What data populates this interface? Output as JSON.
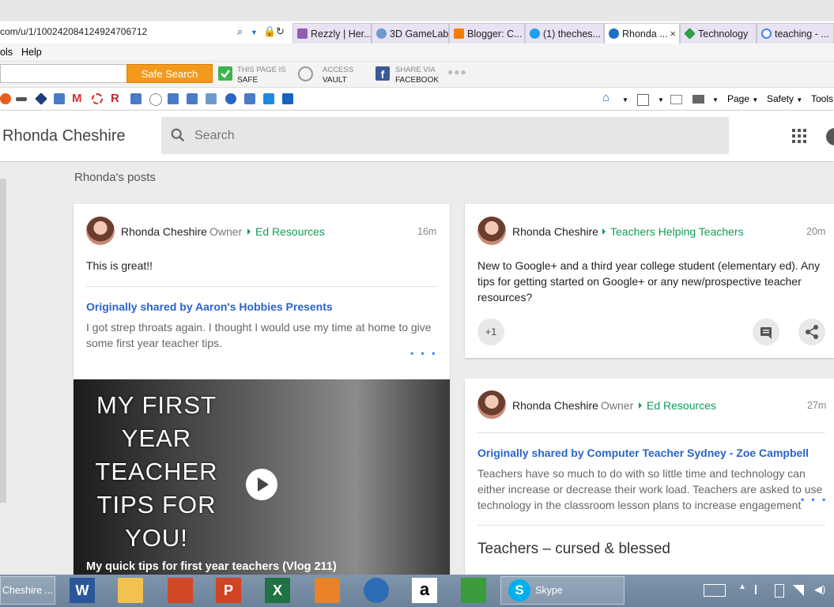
{
  "browser": {
    "address": "com/u/1/100242084124924706712",
    "tabs": [
      {
        "label": "Rezzly | Her...",
        "color": "#8e5fb0"
      },
      {
        "label": "3D GameLab",
        "color": "#6d9acb"
      },
      {
        "label": "Blogger: C...",
        "color": "#f57d00"
      },
      {
        "label": "(1) theches...",
        "color": "#1da1f2"
      },
      {
        "label": "Rhonda ...",
        "color": "#1e6fc8",
        "close": "×"
      },
      {
        "label": "Technology",
        "color": "#2f9e44"
      },
      {
        "label": "teaching - ...",
        "color": "#4285f4"
      }
    ],
    "menu": {
      "tools": "ols",
      "help": "Help"
    },
    "safebar": {
      "safe_search": "Safe Search",
      "page_safe_line1": "THIS PAGE IS",
      "page_safe_line2": "SAFE",
      "access_line1": "ACCESS",
      "access_line2": "VAULT",
      "share_line1": "SHARE VIA",
      "share_line2": "FACEBOOK",
      "more": "●●●"
    },
    "commands": {
      "page": "Page",
      "safety": "Safety",
      "tools": "Tools"
    }
  },
  "gplus": {
    "profile_name": "Rhonda Cheshire",
    "search_placeholder": "Search",
    "posts_heading": "Rhonda's posts"
  },
  "posts": [
    {
      "author": "Rhonda Cheshire",
      "role": "Owner",
      "community": "Ed Resources",
      "time": "16m",
      "text": "This is great!!",
      "shared_by": "Originally shared by Aaron's Hobbies Presents",
      "shared_text": "I got strep throats again. I thought I would use my time at home to give some first year teacher tips.",
      "more": "• • •",
      "video_title_text": "MY FIRST YEAR TEACHER TIPS FOR YOU!",
      "video_caption": "My quick tips for first year teachers (Vlog 211)"
    },
    {
      "author": "Rhonda Cheshire",
      "community": "Teachers Helping Teachers",
      "time": "20m",
      "text": "New to Google+ and a third year college student (elementary ed). Any tips for getting started on Google+ or any new/prospective teacher resources?",
      "plus_one": "+1"
    },
    {
      "author": "Rhonda Cheshire",
      "role": "Owner",
      "community": "Ed Resources",
      "time": "27m",
      "shared_by": "Originally shared by Computer Teacher Sydney - Zoe Campbell",
      "shared_text": "Teachers have so much to do with so little time and technology can either increase or decrease their work load. Teachers are asked to use technology in the classroom lesson plans to increase engagement",
      "more": "• • •",
      "headline": "Teachers – cursed & blessed"
    }
  ],
  "taskbar": {
    "active_window": "Cheshire ...",
    "skype": "Skype"
  }
}
